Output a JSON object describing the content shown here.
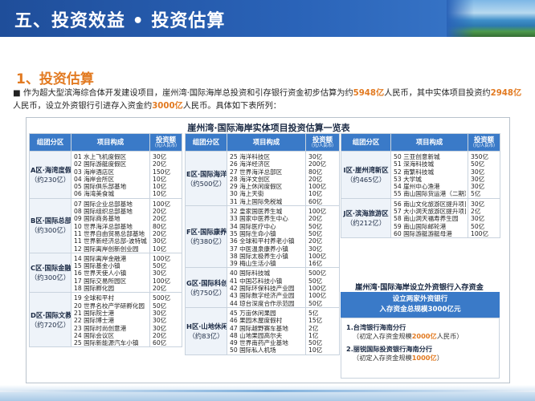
{
  "header": {
    "title": "五、投资效益 • 投资估算"
  },
  "section": {
    "title": "1、投资估算"
  },
  "intro": {
    "bullet": "■",
    "p1": " 作为超大型滨海综合体开发建设项目，崖州湾·国际海岸总投资和引存银行资金初步估算为约",
    "v1": "5948亿",
    "p2": "人民币，其中实体项目投资约",
    "v2": "2948亿",
    "p3": "人民币，设立外资银行引进存入资金约",
    "v3": "3000亿",
    "p4": "人民币。具体如下表所列："
  },
  "table_title": "崖州湾·国际海岸实体项目投资估算一览表",
  "headers": {
    "zone": "组团分区",
    "items": "项目构成",
    "value": "投资额",
    "value_unit": "（元/人民币）"
  },
  "columns": [
    {
      "zones": [
        {
          "name": "A区·海湾度假带",
          "area": "（约230亿）",
          "items": [
            "01 水上飞机度假区",
            "02 国际游艇度假区",
            "03 海岸酒店区",
            "04 海岸会所区",
            "05 国际俱乐部基地",
            "06 海湾美食城"
          ],
          "values": [
            "30亿",
            "20亿",
            "150亿",
            "10亿",
            "10亿",
            "10亿"
          ]
        },
        {
          "name": "B区·国际总部区",
          "area": "（约300亿）",
          "items": [
            "07 国际企业总部基地",
            "08 国际组织总部基地",
            "09 国际商务基地",
            "10 世界海洋总部基地",
            "11 世界自由贸易总部基地",
            "11 世界新经济总部-波特城",
            "12 国际离岸创新创业园"
          ],
          "values": [
            "100亿",
            "20亿",
            "20亿",
            "80亿",
            "20亿",
            "30亿",
            "10亿"
          ]
        },
        {
          "name": "C区·国际金融区",
          "area": "（约300亿）",
          "items": [
            "14 国际离岸金融港",
            "15 国际基金小镇",
            "16 世界天使人小镇",
            "17 国际交易所园区",
            "18 国际孵化园"
          ],
          "values": [
            "100亿",
            "50亿",
            "30亿",
            "100亿",
            "20亿"
          ]
        },
        {
          "name": "D区·国际文教区",
          "area": "（约720亿）",
          "items": [
            "19 全球和平村",
            "20 世界名校产学研孵化园",
            "21 国际院士港",
            "22 国际博士港",
            "23 国际时尚创意港",
            "24 国际会议区",
            "25 国际新能源汽车小镇"
          ],
          "values": [
            "500亿",
            "50亿",
            "30亿",
            "30亿",
            "30亿",
            "20亿",
            "60亿"
          ]
        }
      ]
    },
    {
      "zones": [
        {
          "name": "E区·国际海洋城",
          "area": "（约500亿）",
          "items": [
            "25 海洋科技区",
            "26 海洋经济区",
            "27 世界海洋总部区",
            "28 海洋文创区",
            "29 海上休闲度假区",
            "30 海上天街",
            "31 海上国际免税城"
          ],
          "values": [
            "30亿",
            "200亿",
            "80亿",
            "20亿",
            "100亿",
            "10亿",
            "60亿"
          ]
        },
        {
          "name": "F区·国际康养区",
          "area": "（约380亿）",
          "items": [
            "32 皇家国医养生城",
            "33 国家中医养生中心",
            "34 国际医疗中心",
            "35 国际生命小镇",
            "36 全球和平村养老小镇",
            "37 中医温泉康养小镇",
            "38 国际太极养生小镇",
            "39 梅山生活小镇"
          ],
          "values": [
            "100亿",
            "20亿",
            "50亿",
            "50亿",
            "20亿",
            "30亿",
            "100亿",
            "16亿"
          ]
        },
        {
          "name": "G区·国际科创区",
          "area": "（约750亿）",
          "items": [
            "40 国际科技城",
            "41 中国芯科技小镇",
            "42 国际环保科技产业园",
            "43 国际数字经济产业园",
            "44 琼台深度合作示范园"
          ],
          "values": [
            "500亿",
            "50亿",
            "100亿",
            "100亿",
            "50亿"
          ]
        },
        {
          "name": "H区·山地休闲谷",
          "area": "（约83亿）",
          "items": [
            "45 万亩休闲果园",
            "46 果园木屋度假村",
            "47 国际越野赛车基地",
            "48 山地果园高尔夫",
            "49 世界南药产业基地",
            "50 国际私人机场"
          ],
          "values": [
            "5亿",
            "15亿",
            "2亿",
            "1亿",
            "50亿",
            "10亿"
          ]
        }
      ]
    },
    {
      "zones": [
        {
          "name": "I区·崖州湾新区",
          "area": "（约465亿）",
          "items": [
            "50 三亚创意新城",
            "51 深海科技城",
            "52 南繁科技城",
            "53 大学城",
            "54 崖州中心渔港",
            "55 南山国际货运港（二期）"
          ],
          "values": [
            "350亿",
            "50亿",
            "30亿",
            "30亿",
            "30亿",
            "5亿"
          ]
        },
        {
          "name": "J区·滨海旅游区",
          "area": "（约212亿）",
          "items": [
            "56 南山文化旅游区提升项目",
            "57 大小洞天旅游区提升项目",
            "58 南山洞天福寿养生园",
            "59 南山国际邮轮港",
            "60 国际游艇游艇母港"
          ],
          "values": [
            "30亿",
            "2亿",
            "30亿",
            "50亿",
            "100亿"
          ]
        }
      ]
    }
  ],
  "fund": {
    "title": "崖州湾·国际海岸设立外资银行入存资金",
    "head_line1": "设立两家外资银行",
    "head_line2": "入存资金总规模3000亿元",
    "banks": [
      {
        "name": "1.台湾银行海南分行",
        "note_pre": "（初定入存资金规模",
        "note_val": "2000亿",
        "note_post": "人民币）"
      },
      {
        "name": "2.丽锐国际投资银行海南分行",
        "note_pre": "（初定入存资金规模",
        "note_val": "1000亿",
        "note_post": "）"
      }
    ]
  },
  "colors": {
    "header_blue": "#2a63b8",
    "table_header": "#3a7ac8",
    "accent_orange": "#e27a21",
    "zone_bg": "#eef3f9"
  }
}
